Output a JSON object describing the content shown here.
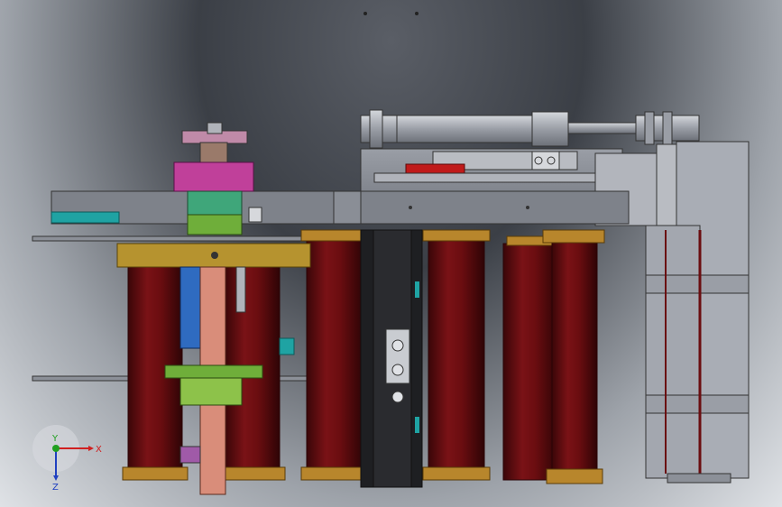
{
  "viewport": {
    "background_colors": [
      "#3b3f46",
      "#9ea3aa",
      "#dfe2e6"
    ]
  },
  "triad": {
    "x_label": "X",
    "y_label": "Y",
    "z_label": "Z",
    "x_color": "#d02020",
    "y_color": "#20a020",
    "z_color": "#2040c0"
  },
  "colors": {
    "roller": "#6a0d10",
    "roller_edge": "#3a0608",
    "flange": "#b8862c",
    "frame": "#a9adb5",
    "magenta": "#c0409a",
    "green": "#6fae3a",
    "gold": "#b6932f",
    "red_block": "#c01a1a",
    "blue_rod": "#2f6bc0",
    "teal": "#1fa3a3",
    "copper": "#d98d7a"
  }
}
